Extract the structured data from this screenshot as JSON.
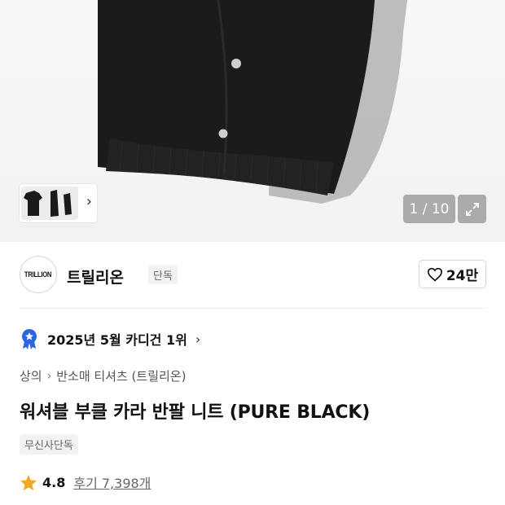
{
  "gallery": {
    "counter": "1 / 10",
    "thumbnail_arrow": "›"
  },
  "brand": {
    "logo_text": "TRILLION",
    "name": "트릴리온",
    "badge": "단독",
    "likes": "24만"
  },
  "ranking": {
    "text": "2025년 5월 카디건 1위",
    "chevron": "›"
  },
  "breadcrumb": {
    "items": [
      "상의",
      "반소매 티셔츠 (트릴리온)"
    ],
    "separator": "›"
  },
  "product": {
    "title": "워셔블 부클 카라 반팔 니트 (PURE BLACK)",
    "tag": "무신사단독"
  },
  "rating": {
    "score": "4.8",
    "reviews_label": "후기 7,398개"
  },
  "colors": {
    "star": "#f5a623",
    "rank_badge": "#2d63e6",
    "garment": "#1a1a1a"
  }
}
